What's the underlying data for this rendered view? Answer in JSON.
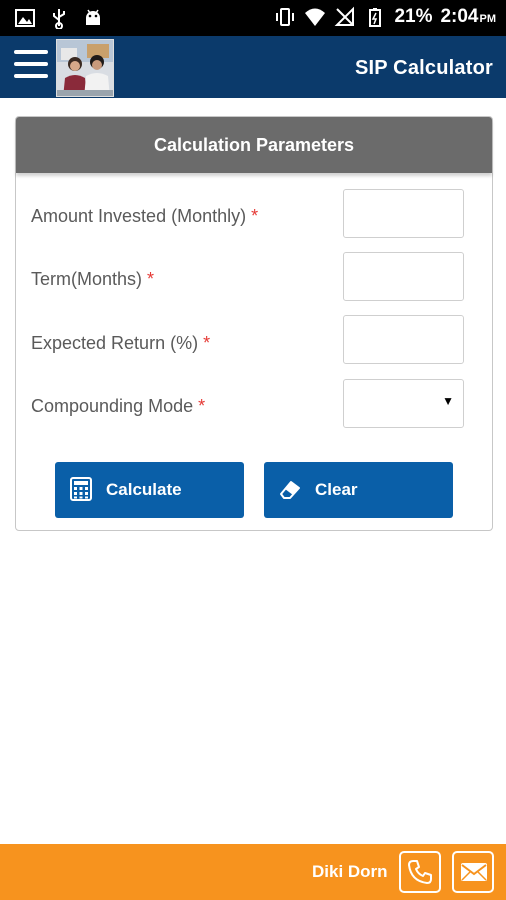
{
  "status_bar": {
    "battery": "21%",
    "time": "2:04",
    "ampm": "PM",
    "icons": [
      "image-icon",
      "usb-icon",
      "android-icon",
      "vibrate-icon",
      "wifi-icon",
      "no-signal-icon",
      "battery-icon"
    ]
  },
  "header": {
    "title": "SIP Calculator",
    "menu_icon": "hamburger-icon"
  },
  "panel": {
    "title": "Calculation Parameters",
    "required_mark": "*",
    "fields": [
      {
        "label": "Amount Invested (Monthly)",
        "value": ""
      },
      {
        "label": "Term(Months)",
        "value": ""
      },
      {
        "label": "Expected Return (%)",
        "value": ""
      }
    ],
    "select": {
      "label": "Compounding Mode",
      "value": "",
      "arrow": "▼"
    },
    "buttons": {
      "calculate": "Calculate",
      "clear": "Clear"
    }
  },
  "footer": {
    "name": "Diki Dorn",
    "phone_icon": "phone-icon",
    "mail_icon": "mail-icon"
  },
  "colors": {
    "header_bg": "#0b3a6b",
    "panel_header_bg": "#6b6b6b",
    "button_bg": "#0a5fa8",
    "footer_bg": "#f7931e",
    "required": "#e53935"
  }
}
